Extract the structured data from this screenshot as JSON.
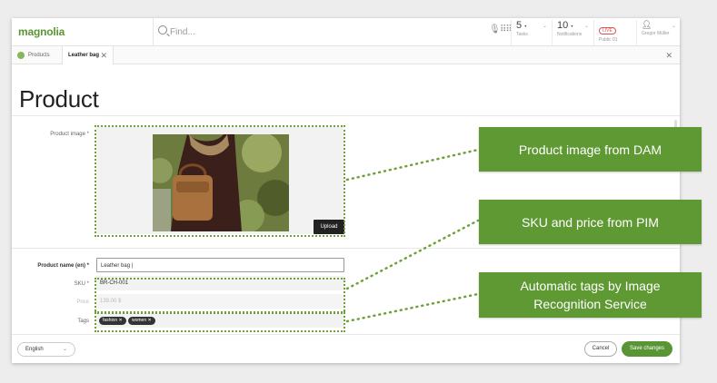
{
  "app": {
    "logo": "magnolia",
    "search_placeholder": "Find..."
  },
  "topbar": {
    "tasks": {
      "count": "5",
      "label": "Tasks"
    },
    "notifications": {
      "count": "10",
      "label": "Notifications"
    },
    "environment": {
      "badge": "LIVE",
      "label": "Public 01"
    },
    "user": {
      "name": "Gregor Müller"
    }
  },
  "tabs": {
    "home": "Products",
    "active": "Leather bag"
  },
  "page": {
    "title": "Product"
  },
  "form": {
    "product_image_label": "Product image *",
    "upload_label": "Upload",
    "product_name_label": "Product name (en) *",
    "product_name_value": "Leather bag |",
    "sku_label": "SKU *",
    "sku_value": "BR-CH-001",
    "price_label": "Price",
    "price_value": "139.00 $",
    "tags_label": "Tags",
    "tags": [
      "fashion",
      "women"
    ]
  },
  "footer": {
    "language": "English",
    "cancel": "Cancel",
    "save": "Save changes"
  },
  "callouts": {
    "dam": "Product image from DAM",
    "pim": "SKU and price from PIM",
    "tags": "Automatic tags by Image Recognition Service"
  },
  "colors": {
    "brand_green": "#599534",
    "callout_green": "#5e9933",
    "dotted_green": "#6fa13b"
  },
  "icons": {
    "search": "search-icon",
    "mic": "microphone-icon",
    "grid": "apps-grid-icon",
    "user": "user-icon",
    "close": "close-icon"
  }
}
